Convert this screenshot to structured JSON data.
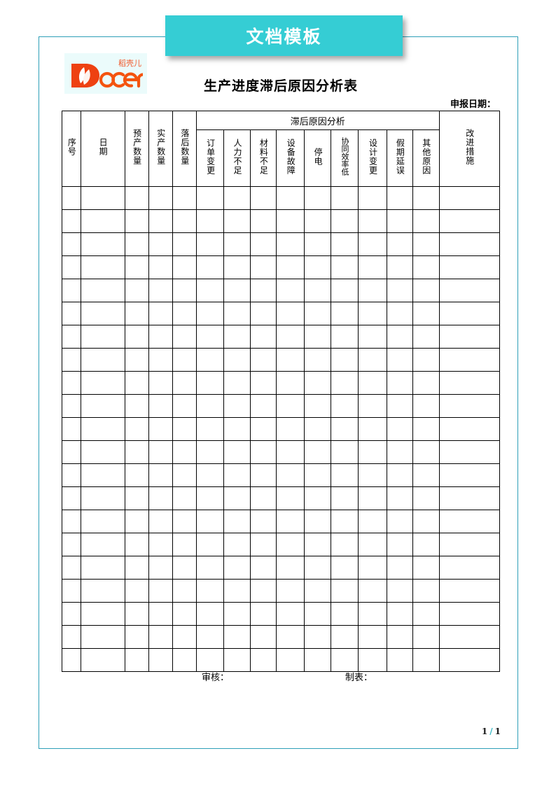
{
  "banner": {
    "title": "文档模板",
    "bg_color": "#35cdd4"
  },
  "logo": {
    "wordmark": "Docer",
    "chinese": "稻壳儿",
    "color": "#f4540f"
  },
  "document": {
    "title": "生产进度滞后原因分析表",
    "declare_date_label": "申报日期："
  },
  "table": {
    "columns": [
      {
        "label": "序号",
        "group": null
      },
      {
        "label": "日期",
        "group": null
      },
      {
        "label": "预产数量",
        "group": null
      },
      {
        "label": "实产数量",
        "group": null
      },
      {
        "label": "落后数量",
        "group": null
      },
      {
        "label": "订单变更",
        "group": "滞后原因分析"
      },
      {
        "label": "人力不足",
        "group": "滞后原因分析"
      },
      {
        "label": "材料不足",
        "group": "滞后原因分析"
      },
      {
        "label": "设备故障",
        "group": "滞后原因分析"
      },
      {
        "label": "停电",
        "group": "滞后原因分析"
      },
      {
        "label": "协同效率低",
        "group": "滞后原因分析"
      },
      {
        "label": "设计变更",
        "group": "滞后原因分析"
      },
      {
        "label": "假期延误",
        "group": "滞后原因分析"
      },
      {
        "label": "其他原因",
        "group": "滞后原因分析"
      },
      {
        "label": "改进措施",
        "group": null
      }
    ],
    "group_header": "滞后原因分析",
    "empty_row_count": 21
  },
  "footer": {
    "review_label": "审核：",
    "maker_label": "制表："
  },
  "page_number": {
    "current": "1",
    "separator": "/",
    "total": "1"
  }
}
